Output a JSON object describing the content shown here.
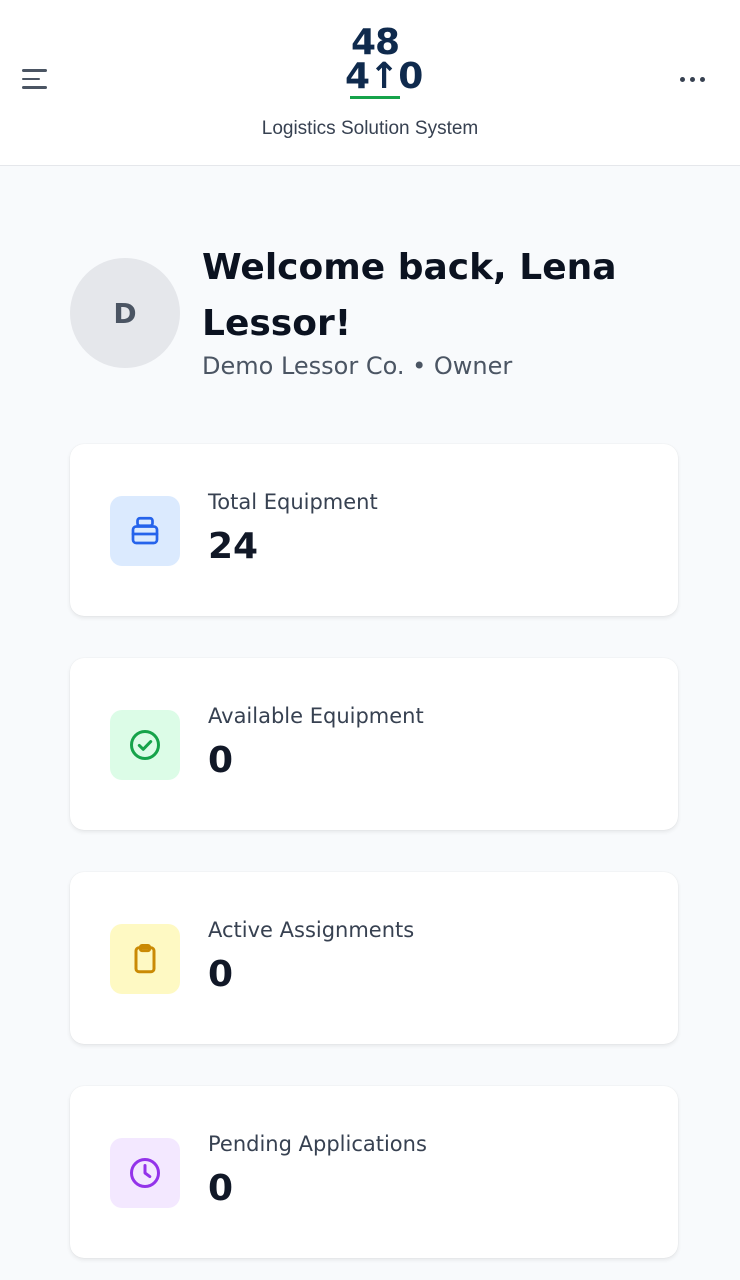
{
  "header": {
    "logo": {
      "line1": "48",
      "line2": "4↑0"
    },
    "tagline": "Logistics Solution System",
    "menu_icon": "hamburger-menu-icon",
    "more_icon": "more-horizontal-icon"
  },
  "welcome": {
    "avatar_initial": "D",
    "title": "Welcome back, Lena Lessor!",
    "subtitle": "Demo Lessor Co. • Owner"
  },
  "stats": [
    {
      "label": "Total Equipment",
      "value": "24",
      "icon": "inbox-stack-icon",
      "color": "#2563eb",
      "bg": "#dbeafe"
    },
    {
      "label": "Available Equipment",
      "value": "0",
      "icon": "check-circle-icon",
      "color": "#16a34a",
      "bg": "#dcfce7"
    },
    {
      "label": "Active Assignments",
      "value": "0",
      "icon": "clipboard-icon",
      "color": "#ca8a04",
      "bg": "#fef9c3"
    },
    {
      "label": "Pending Applications",
      "value": "0",
      "icon": "clock-icon",
      "color": "#9333ea",
      "bg": "#f3e8ff"
    }
  ]
}
